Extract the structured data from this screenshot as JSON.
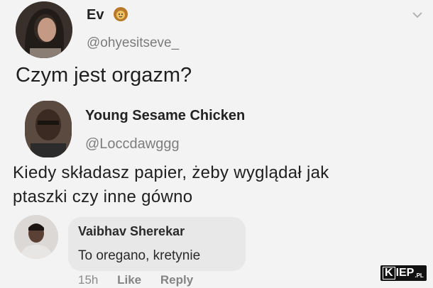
{
  "tweet1": {
    "name": "Ev",
    "name_icon": "lion-emoji-icon",
    "handle": "@ohyesitseve_",
    "text": "Czym jest orgazm?"
  },
  "tweet2": {
    "name": "Young Sesame Chicken",
    "handle": "@Loccdawggg",
    "text_line1": "Kiedy składasz papier, żeby wyglądał jak",
    "text_line2": "ptaszki czy inne gówno"
  },
  "comment": {
    "name": "Vaibhav Sherekar",
    "text": "To oregano, kretynie",
    "time": "15h",
    "like_label": "Like",
    "reply_label": "Reply"
  },
  "watermark": {
    "k": "K",
    "rest": "IEP",
    "suffix": ".PL"
  }
}
